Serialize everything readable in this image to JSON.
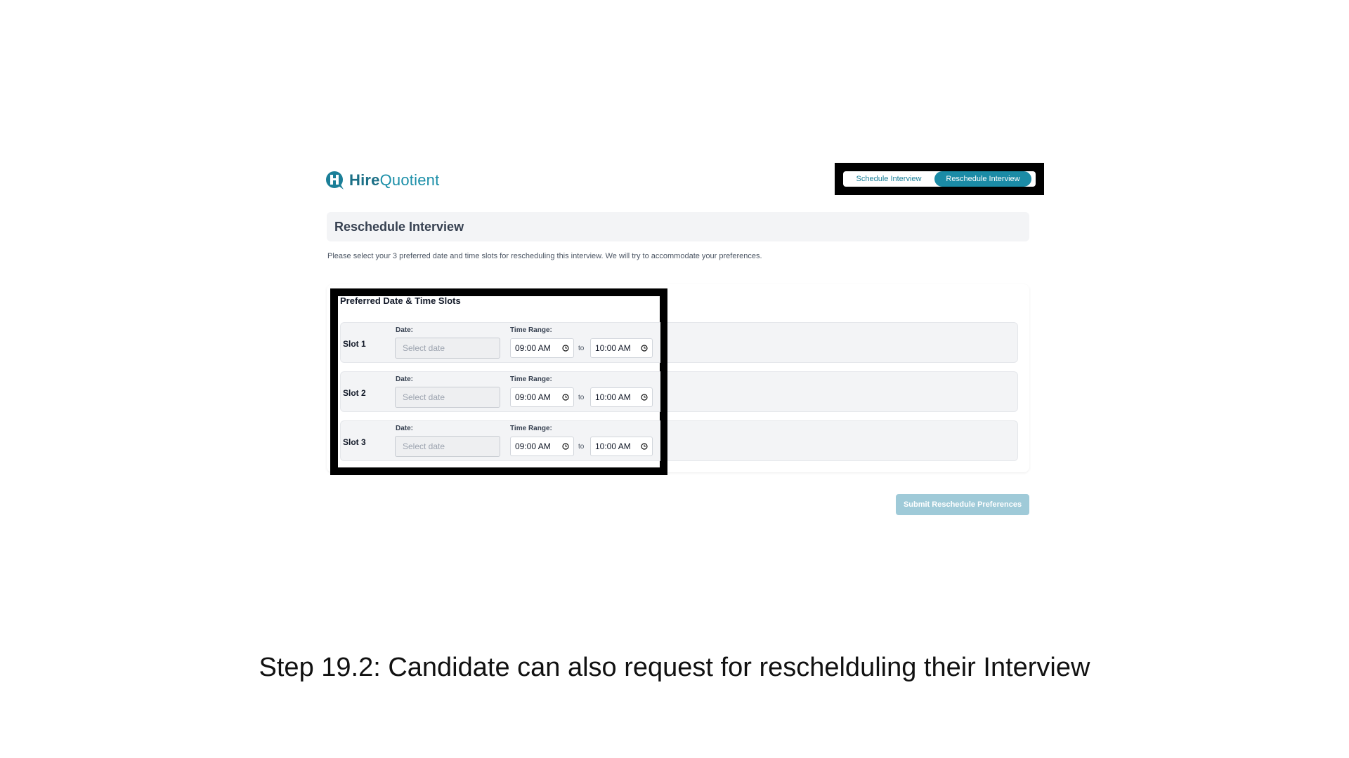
{
  "logo": {
    "text_bold": "Hire",
    "text_regular": "Quotient",
    "icon": "hirequotient-logo-icon"
  },
  "toggle": {
    "schedule_label": "Schedule Interview",
    "reschedule_label": "Reschedule Interview",
    "active": "reschedule"
  },
  "page": {
    "title": "Reschedule Interview",
    "description": "Please select your 3 preferred date and time slots for rescheduling this interview. We will try to accommodate your preferences."
  },
  "section_title": "Preferred Date & Time Slots",
  "slots": [
    {
      "label": "Slot 1",
      "date_label": "Date:",
      "date_placeholder": "Select date",
      "time_label": "Time Range:",
      "start": "09:00 AM",
      "to": "to",
      "end": "10:00 AM"
    },
    {
      "label": "Slot 2",
      "date_label": "Date:",
      "date_placeholder": "Select date",
      "time_label": "Time Range:",
      "start": "09:00 AM",
      "to": "to",
      "end": "10:00 AM"
    },
    {
      "label": "Slot 3",
      "date_label": "Date:",
      "date_placeholder": "Select date",
      "time_label": "Time Range:",
      "start": "09:00 AM",
      "to": "to",
      "end": "10:00 AM"
    }
  ],
  "submit_label": "Submit Reschedule Preferences",
  "caption": "Step 19.2: Candidate can also request for reschelduling their Interview",
  "colors": {
    "brand": "#1b8ba6",
    "submit_disabled": "#9fcad8",
    "highlight_frame": "#000000"
  }
}
